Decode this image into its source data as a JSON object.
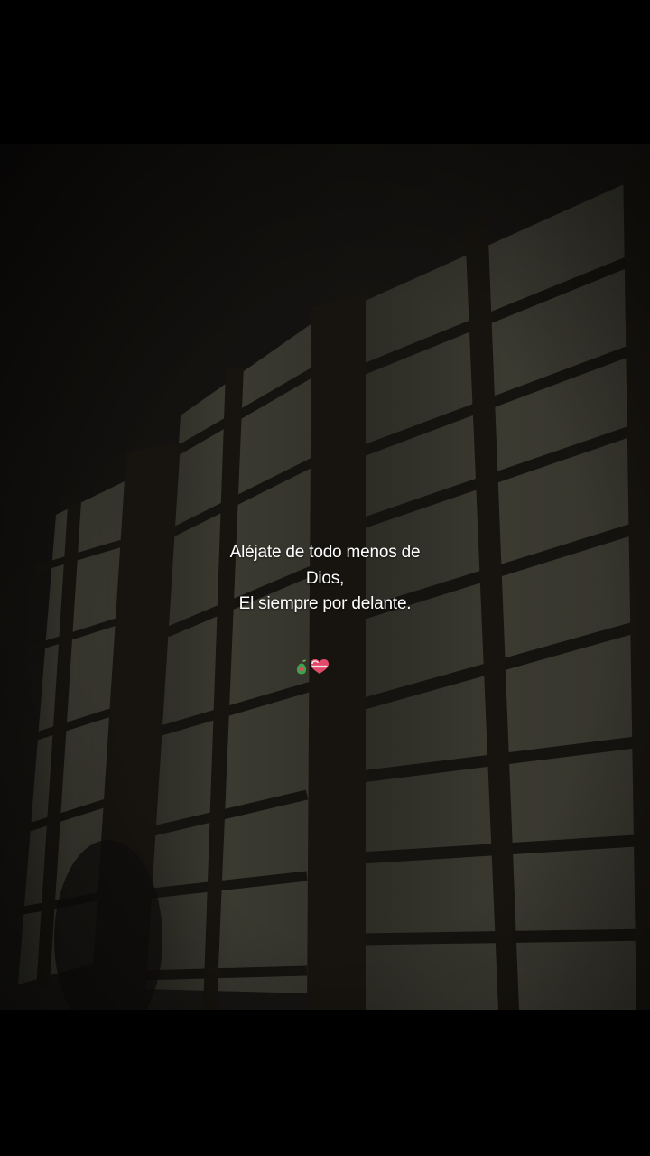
{
  "caption": {
    "line1": "Aléjate de todo menos de",
    "line2": "Dios,",
    "line3": "El siempre por delante."
  },
  "emojis": [
    "pear-emoji",
    "heart-emoji"
  ],
  "colors": {
    "letterbox": "#000000",
    "text": "#ffffff",
    "window_light": "#3b3a30",
    "frame_dark": "#17140f"
  }
}
